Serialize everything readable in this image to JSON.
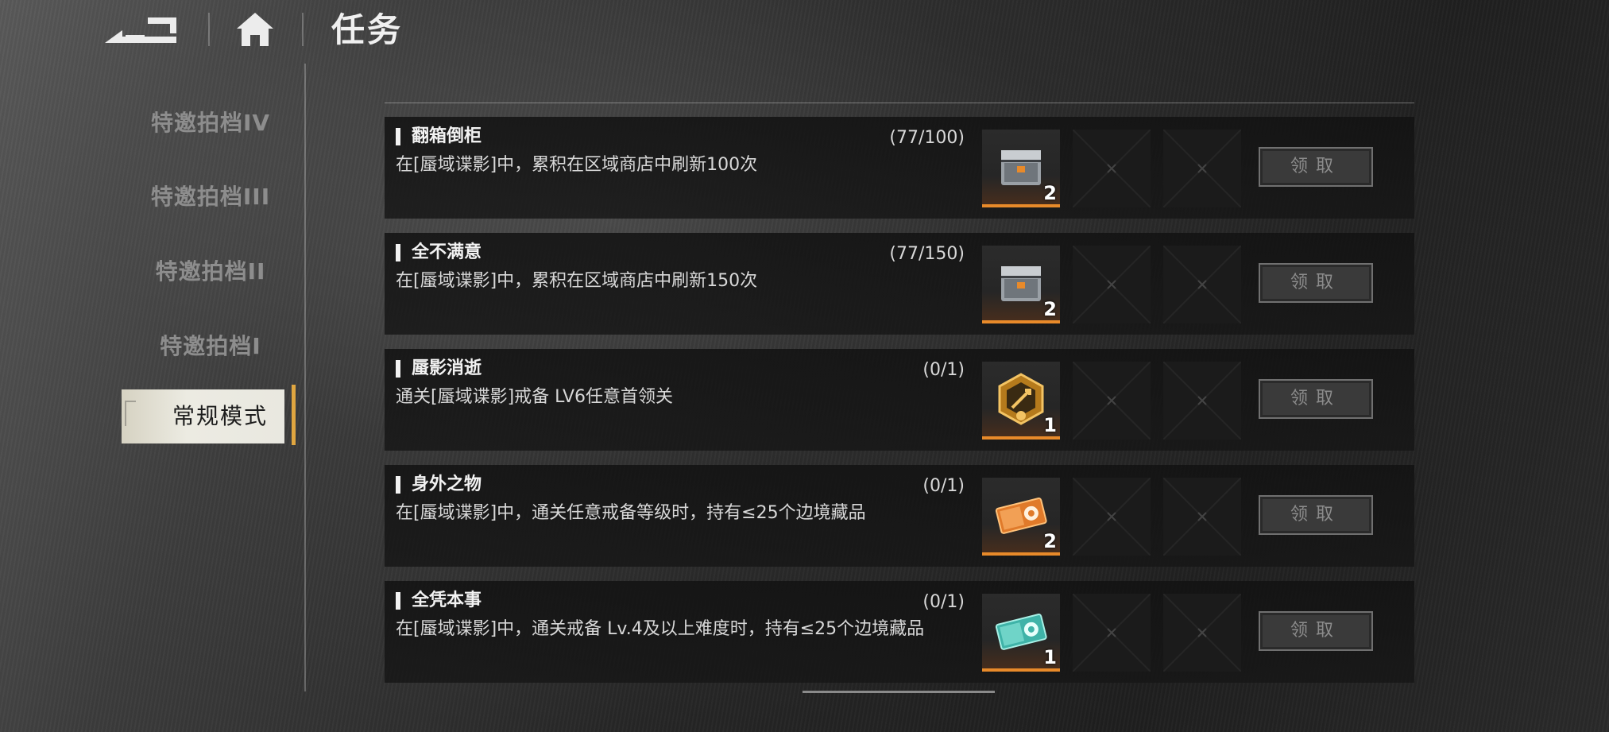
{
  "header": {
    "title": "任务",
    "back_icon": "back-arrow-icon",
    "home_icon": "home-icon"
  },
  "sidebar": {
    "items": [
      {
        "label": "特邀拍档IV"
      },
      {
        "label": "特邀拍档III"
      },
      {
        "label": "特邀拍档II"
      },
      {
        "label": "特邀拍档Ⅰ"
      },
      {
        "label": "常规模式"
      }
    ],
    "active_index": 4,
    "accent_color": "#e0a640"
  },
  "tasks": [
    {
      "title": "翻箱倒柜",
      "desc": "在[蜃域谍影]中，累积在区域商店中刷新100次",
      "progress": "(77/100)",
      "reward": {
        "icon": "supply-crate-icon",
        "qty": "2"
      },
      "claim_label": "领取"
    },
    {
      "title": "全不满意",
      "desc": "在[蜃域谍影]中，累积在区域商店中刷新150次",
      "progress": "(77/150)",
      "reward": {
        "icon": "supply-crate-icon",
        "qty": "2"
      },
      "claim_label": "领取"
    },
    {
      "title": "蜃影消逝",
      "desc": "通关[蜃域谍影]戒备 LV6任意首领关",
      "progress": "(0/1)",
      "reward": {
        "icon": "gold-emblem-icon",
        "qty": "1"
      },
      "claim_label": "领取"
    },
    {
      "title": "身外之物",
      "desc": "在[蜃域谍影]中，通关任意戒备等级时，持有≤25个边境藏品",
      "progress": "(0/1)",
      "reward": {
        "icon": "orange-ticket-icon",
        "qty": "2"
      },
      "claim_label": "领取"
    },
    {
      "title": "全凭本事",
      "desc": "在[蜃域谍影]中，通关戒备 Lv.4及以上难度时，持有≤25个边境藏品",
      "progress": "(0/1)",
      "reward": {
        "icon": "teal-ticket-icon",
        "qty": "1"
      },
      "claim_label": "领取"
    }
  ],
  "colors": {
    "reward_bar": "#e88a2a",
    "button_border": "#707070",
    "button_text": "#8c8c8c"
  }
}
